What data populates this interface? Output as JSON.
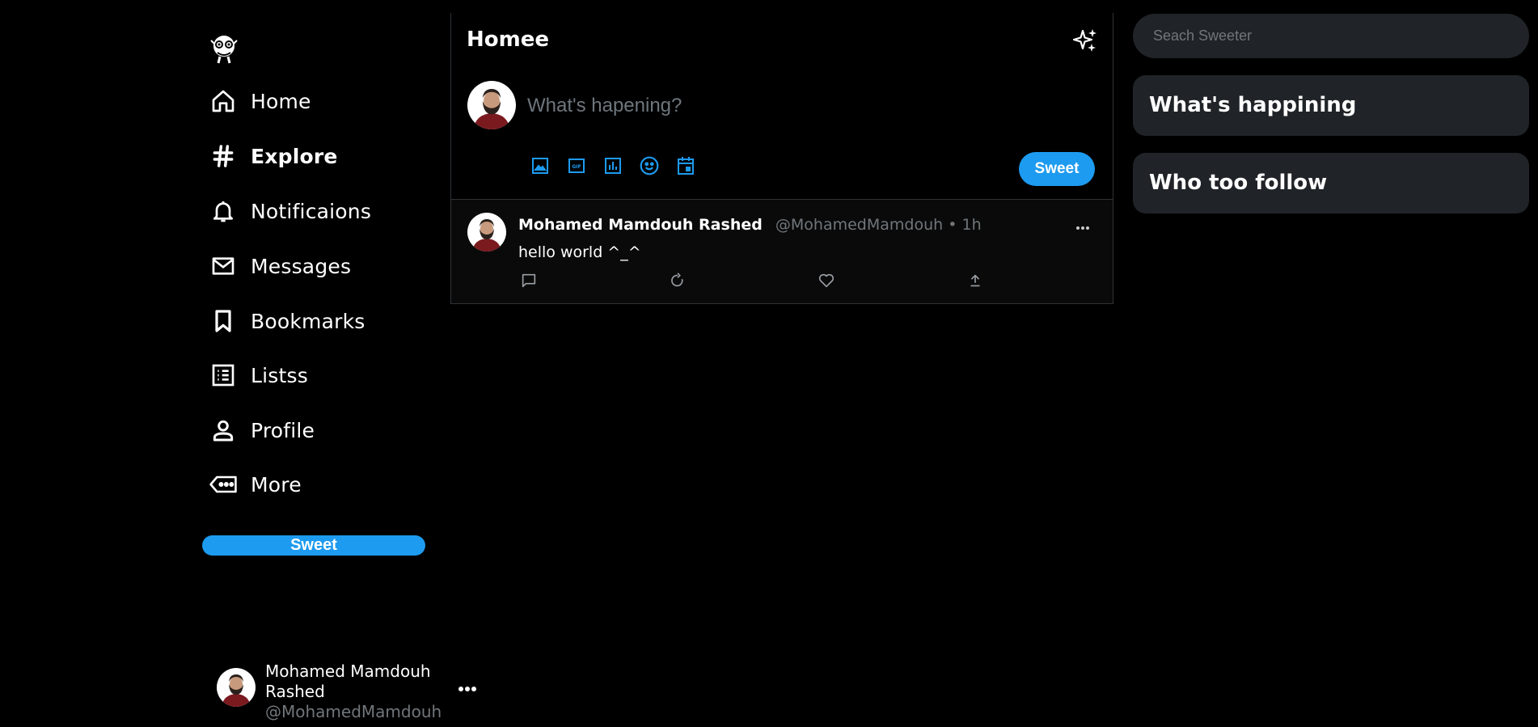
{
  "sidebar": {
    "logo": "mascot-logo",
    "nav": [
      {
        "label": "Home",
        "icon": "home-icon"
      },
      {
        "label": "Explore",
        "icon": "hashtag-icon"
      },
      {
        "label": "Notificaions",
        "icon": "bell-icon"
      },
      {
        "label": "Messages",
        "icon": "mail-icon"
      },
      {
        "label": "Bookmarks",
        "icon": "bookmark-icon"
      },
      {
        "label": "Listss",
        "icon": "list-icon"
      },
      {
        "label": "Profile",
        "icon": "person-icon"
      },
      {
        "label": "More",
        "icon": "more-tag-icon"
      }
    ],
    "active_item": "Explore",
    "sweet_button": "Sweet",
    "account": {
      "name": "Mohamed Mamdouh Rashed",
      "handle": "@MohamedMamdouh"
    }
  },
  "main": {
    "title": "Homee",
    "composer": {
      "placeholder": "What's hapening?",
      "tools": [
        "image-icon",
        "gif-icon",
        "poll-icon",
        "emoji-icon",
        "schedule-icon"
      ],
      "sweet_button": "Sweet"
    },
    "tweet": {
      "name": "Mohamed Mamdouh Rashed",
      "handle": "@MohamedMamdouh",
      "separator": "•",
      "time": "1h",
      "text": "hello world ^_^",
      "actions": [
        "reply-icon",
        "resweet-icon",
        "like-icon",
        "share-icon"
      ]
    }
  },
  "right": {
    "search_placeholder": "Seach Sweeter",
    "panels": [
      "What's happining",
      "Who too follow"
    ]
  },
  "colors": {
    "accent": "#1d9bf0",
    "background": "#000000",
    "panel": "#202327",
    "muted_text": "#71767b"
  }
}
